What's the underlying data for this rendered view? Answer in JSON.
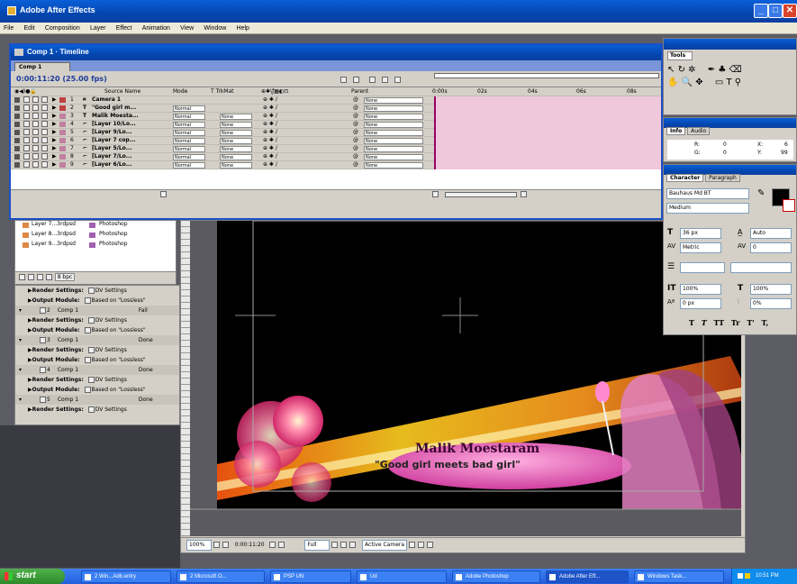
{
  "app": {
    "title": "Adobe After Effects",
    "menu": [
      "File",
      "Edit",
      "Composition",
      "Layer",
      "Effect",
      "Animation",
      "View",
      "Window",
      "Help"
    ]
  },
  "timeline": {
    "title": "Comp 1 · Timeline",
    "tab": "Comp 1",
    "timecode": "0:00:11:20 (25.00 fps)",
    "columns": [
      "Source Name",
      "Mode",
      "T  TrkMat",
      "Parent"
    ],
    "ruler": [
      "0:00s",
      "02s",
      "04s",
      "06s",
      "08s"
    ],
    "layers": [
      {
        "num": "1",
        "name": "Camera 1",
        "mode": "",
        "trk": "",
        "parent": "None",
        "color": "#c04040",
        "icon": "camera-icon"
      },
      {
        "num": "2",
        "name": "\"Good girl m...",
        "mode": "Normal",
        "trk": "",
        "parent": "None",
        "color": "#c04040",
        "icon": "text-icon"
      },
      {
        "num": "3",
        "name": "Malik Moesta...",
        "mode": "Normal",
        "trk": "None",
        "parent": "None",
        "color": "#c080a0",
        "icon": "text-icon"
      },
      {
        "num": "4",
        "name": "[Layer 10/Lo...",
        "mode": "Normal",
        "trk": "None",
        "parent": "None",
        "color": "#c080a0",
        "icon": "footage-icon"
      },
      {
        "num": "5",
        "name": "[Layer 9/Lo...",
        "mode": "Normal",
        "trk": "None",
        "parent": "None",
        "color": "#c080a0",
        "icon": "footage-icon"
      },
      {
        "num": "6",
        "name": "[Layer 7 cop...",
        "mode": "Normal",
        "trk": "None",
        "parent": "None",
        "color": "#c080a0",
        "icon": "footage-icon"
      },
      {
        "num": "7",
        "name": "[Layer 5/Lo...",
        "mode": "Normal",
        "trk": "None",
        "parent": "None",
        "color": "#c080a0",
        "icon": "footage-icon"
      },
      {
        "num": "8",
        "name": "[Layer 7/Lo...",
        "mode": "Normal",
        "trk": "None",
        "parent": "None",
        "color": "#c080a0",
        "icon": "footage-icon"
      },
      {
        "num": "9",
        "name": "[Layer 6/Lo...",
        "mode": "Normal",
        "trk": "None",
        "parent": "None",
        "color": "#c080a0",
        "icon": "footage-icon"
      }
    ]
  },
  "project": {
    "items": [
      {
        "name": "Layer 7...3rdpsd",
        "type": "Photoshop"
      },
      {
        "name": "Layer 8...3rdpsd",
        "type": "Photoshop"
      },
      {
        "name": "Layer 9...3rdpsd",
        "type": "Photoshop"
      }
    ],
    "bpc": "8 bpc"
  },
  "render_queue": {
    "entries": [
      {
        "render_label": "Render Settings:",
        "render_value": "DV Settings",
        "output_label": "Output Module:",
        "output_value": "Based on \"Lossless\""
      },
      {
        "comp_num": "2",
        "comp": "Comp 1",
        "status": "Fail",
        "render_label": "Render Settings:",
        "render_value": "DV Settings",
        "output_label": "Output Module:",
        "output_value": "Based on \"Lossless\""
      },
      {
        "comp_num": "3",
        "comp": "Comp 1",
        "status": "Done",
        "render_label": "Render Settings:",
        "render_value": "DV Settings",
        "output_label": "Output Module:",
        "output_value": "Based on \"Lossless\""
      },
      {
        "comp_num": "4",
        "comp": "Comp 1",
        "status": "Done",
        "render_label": "Render Settings:",
        "render_value": "DV Settings",
        "output_label": "Output Module:",
        "output_value": "Based on \"Lossless\""
      },
      {
        "comp_num": "5",
        "comp": "Comp 1",
        "status": "Done",
        "render_label": "Render Settings:",
        "render_value": "DV Settings"
      }
    ]
  },
  "comp_viewer": {
    "title_text": "Malik Moestaram",
    "subtitle_text": "\"Good girl meets bad girl\"",
    "zoom": "100%",
    "timecode": "0:00:11:20",
    "resolution": "Full",
    "camera": "Active Camera"
  },
  "tools": {
    "title": "Tools"
  },
  "info": {
    "tabs": [
      "Info",
      "Audio"
    ],
    "r_label": "R:",
    "r_value": "0",
    "g_label": "G:",
    "g_value": "0",
    "x_label": "X:",
    "x_value": "6",
    "y_label": "Y:",
    "y_value": "99"
  },
  "character": {
    "tabs": [
      "Character",
      "Paragraph"
    ],
    "font": "Bauhaus Md BT",
    "style": "Medium",
    "size": "36 px",
    "leading": "Auto",
    "kerning": "Metric",
    "tracking": "0",
    "vscale": "100%",
    "hscale": "100%",
    "baseline": "0 px",
    "tsume": "0%",
    "styles": [
      "T",
      "T",
      "TT",
      "Tr",
      "T'",
      "T,"
    ]
  },
  "taskbar": {
    "start": "start",
    "buttons": [
      {
        "label": "2 Win...Adb.entry",
        "active": false
      },
      {
        "label": "2 Microsoft O...",
        "active": false
      },
      {
        "label": "PSP UN",
        "active": false
      },
      {
        "label": "Ud",
        "active": false
      },
      {
        "label": "Adobe Photoshop",
        "active": false
      },
      {
        "label": "Adobe After Eff...",
        "active": true
      },
      {
        "label": "Windows Task...",
        "active": false
      }
    ],
    "clock": "10:51 PM"
  }
}
